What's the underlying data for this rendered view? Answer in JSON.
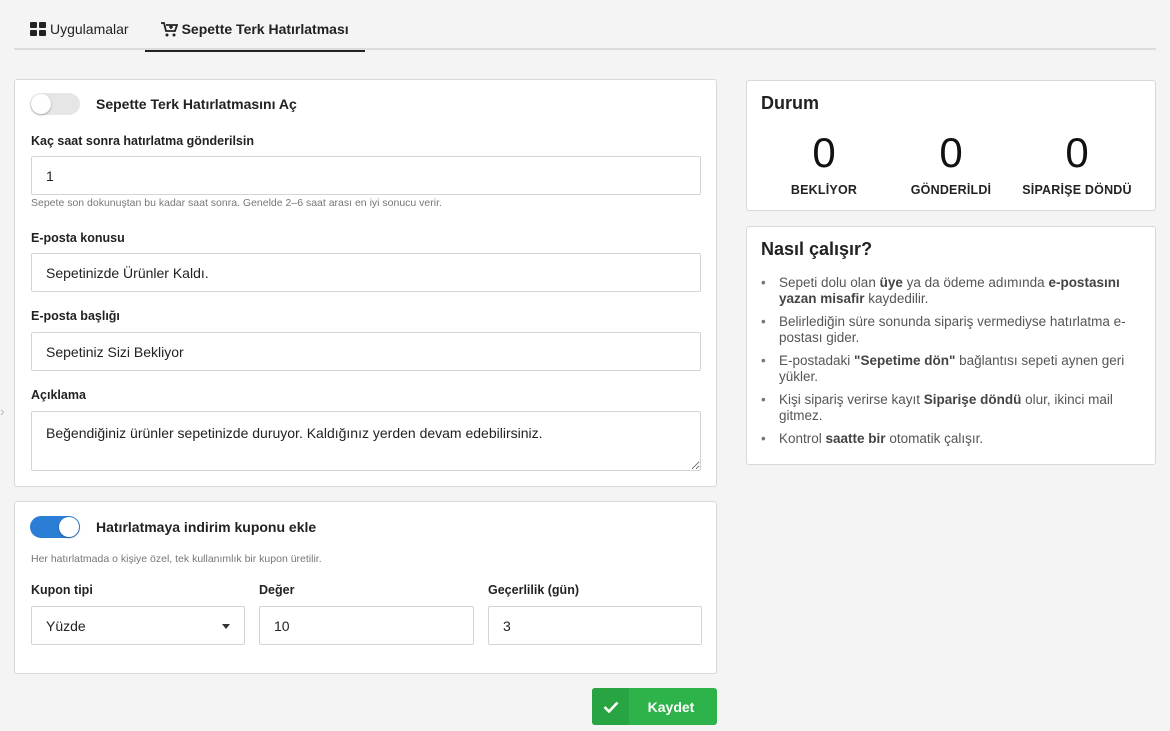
{
  "tabs": [
    {
      "label": "Uygulamalar",
      "icon": "grid-icon",
      "active": false
    },
    {
      "label": "Sepette Terk Hatırlatması",
      "icon": "cart-plus-icon",
      "active": true
    }
  ],
  "reminder": {
    "toggle_label": "Sepette Terk Hatırlatmasını Aç",
    "enabled": false,
    "hours_label": "Kaç saat sonra hatırlatma gönderilsin",
    "hours_value": "1",
    "hours_help": "Sepete son dokunuştan bu kadar saat sonra. Genelde 2–6 saat arası en iyi sonucu verir.",
    "subject_label": "E-posta konusu",
    "subject_value": "Sepetinizde Ürünler Kaldı.",
    "heading_label": "E-posta başlığı",
    "heading_value": "Sepetiniz Sizi Bekliyor",
    "description_label": "Açıklama",
    "description_value": "Beğendiğiniz ürünler sepetinizde duruyor. Kaldığınız yerden devam edebilirsiniz."
  },
  "coupon": {
    "toggle_label": "Hatırlatmaya indirim kuponu ekle",
    "enabled": true,
    "help": "Her hatırlatmada o kişiye özel, tek kullanımlık bir kupon üretilir.",
    "type_label": "Kupon tipi",
    "type_value": "Yüzde",
    "value_label": "Değer",
    "value_value": "10",
    "validity_label": "Geçerlilik (gün)",
    "validity_value": "3"
  },
  "save_label": "Kaydet",
  "status": {
    "title": "Durum",
    "stats": [
      {
        "value": "0",
        "label": "BEKLİYOR"
      },
      {
        "value": "0",
        "label": "GÖNDERİLDİ"
      },
      {
        "value": "0",
        "label": "SİPARİŞE DÖNDÜ"
      }
    ]
  },
  "how": {
    "title": "Nasıl çalışır?",
    "items": [
      {
        "parts": [
          "Sepeti dolu olan ",
          "üye",
          " ya da ödeme adımında ",
          "e-postasını yazan misafir",
          " kaydedilir."
        ]
      },
      {
        "parts": [
          "Belirlediğin süre sonunda sipariş vermediyse hatırlatma e-postası gider."
        ]
      },
      {
        "parts": [
          "E-postadaki ",
          "\"Sepetime dön\"",
          " bağlantısı sepeti aynen geri yükler."
        ]
      },
      {
        "parts": [
          "Kişi sipariş verirse kayıt ",
          "Siparişe döndü",
          " olur, ikinci mail gitmez."
        ]
      },
      {
        "parts": [
          "Kontrol ",
          "saatte bir",
          " otomatik çalışır."
        ]
      }
    ]
  },
  "colors": {
    "primary": "#2a7ed6",
    "success": "#2eb24a"
  }
}
